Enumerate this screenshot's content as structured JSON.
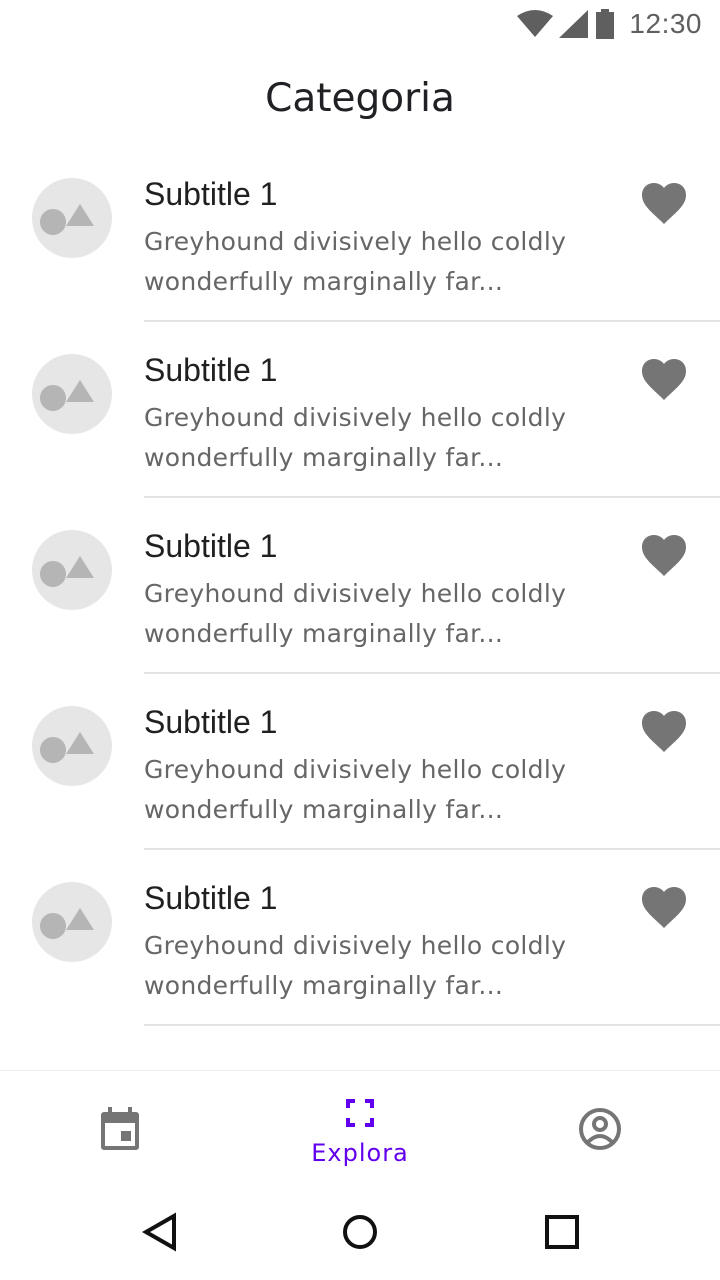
{
  "status_bar": {
    "time": "12:30",
    "icons": [
      "wifi-icon",
      "signal-icon",
      "battery-icon"
    ]
  },
  "header": {
    "title": "Categoria"
  },
  "list": {
    "items": [
      {
        "title": "Subtitle 1",
        "description": "Greyhound divisively hello coldly wonderfully marginally far...",
        "favorite_icon": "heart-icon"
      },
      {
        "title": "Subtitle 1",
        "description": "Greyhound divisively hello coldly wonderfully marginally far...",
        "favorite_icon": "heart-icon"
      },
      {
        "title": "Subtitle 1",
        "description": "Greyhound divisively hello coldly wonderfully marginally far...",
        "favorite_icon": "heart-icon"
      },
      {
        "title": "Subtitle 1",
        "description": "Greyhound divisively hello coldly wonderfully marginally far...",
        "favorite_icon": "heart-icon"
      },
      {
        "title": "Subtitle 1",
        "description": "Greyhound divisively hello coldly wonderfully marginally far...",
        "favorite_icon": "heart-icon"
      }
    ]
  },
  "bottom_nav": {
    "items": [
      {
        "icon": "calendar-icon",
        "label": "",
        "active": false
      },
      {
        "icon": "explore-frame-icon",
        "label": "Explora",
        "active": true
      },
      {
        "icon": "account-circle-icon",
        "label": "",
        "active": false
      }
    ]
  },
  "system_nav": {
    "icons": [
      "back-icon",
      "home-icon",
      "recents-icon"
    ]
  },
  "colors": {
    "accent": "#6200ee",
    "icon_grey": "#757575",
    "divider": "#e3e3e3",
    "thumb_bg": "#e6e6e6"
  }
}
